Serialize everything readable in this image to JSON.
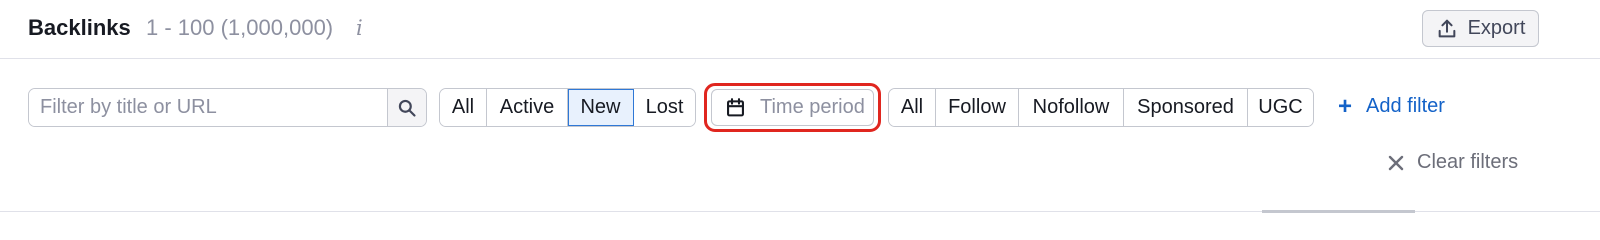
{
  "header": {
    "title": "Backlinks",
    "count": "1 - 100 (1,000,000)",
    "info_icon": "i",
    "export_label": "Export"
  },
  "filters": {
    "search_placeholder": "Filter by title or URL",
    "search_value": "",
    "status_options": [
      "All",
      "Active",
      "New",
      "Lost"
    ],
    "status_selected": "New",
    "time_period_label": "Time period",
    "type_options": [
      "All",
      "Follow",
      "Nofollow",
      "Sponsored",
      "UGC"
    ],
    "add_filter_label": "Add filter",
    "clear_filters_label": "Clear filters"
  },
  "colors": {
    "accent_link": "#1362c8",
    "selected_bg": "#e8f1fd",
    "selected_border": "#2f78d6",
    "highlight_ring": "#e0261f"
  },
  "icons": {
    "export": "upload-icon",
    "search": "search-icon",
    "time_period": "calendar-icon",
    "add_filter": "plus-icon",
    "clear_filters": "close-icon",
    "info": "info-icon"
  }
}
